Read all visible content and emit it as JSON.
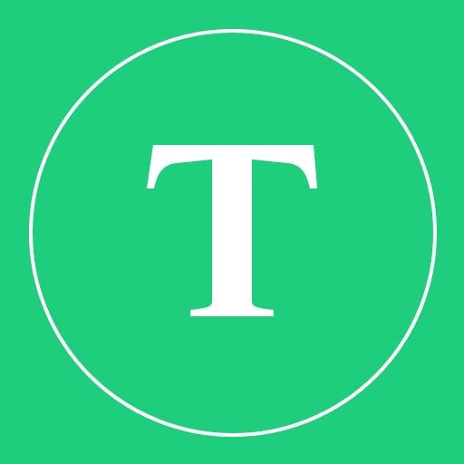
{
  "app_icon": {
    "letter": "T",
    "background_color": "#1fce7c",
    "foreground_color": "#ffffff"
  }
}
